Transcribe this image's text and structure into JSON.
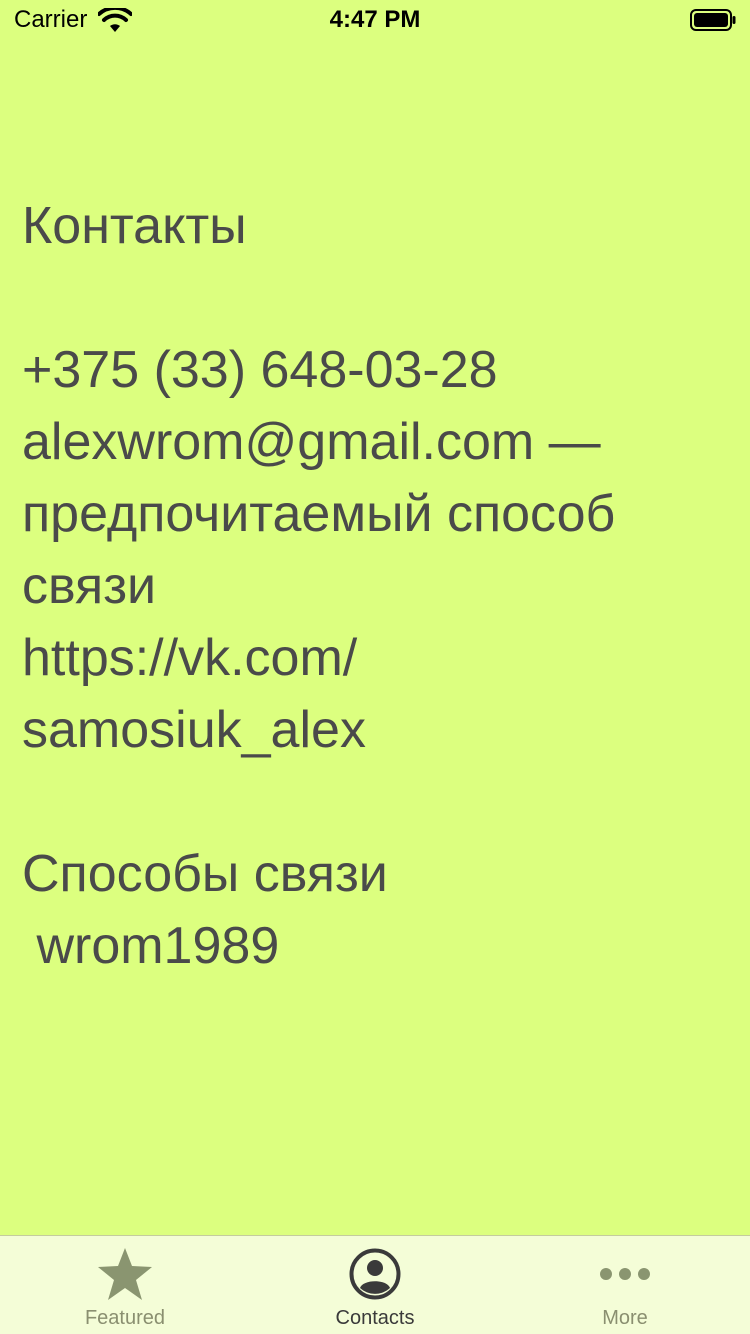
{
  "status_bar": {
    "carrier": "Carrier",
    "time": "4:47 PM"
  },
  "content": {
    "title": "Контакты",
    "phone": "+375 (33) 648-03-28",
    "email_line": "alexwrom@gmail.com —",
    "email_note_1": "предпочитаемый способ",
    "email_note_2": "связи",
    "vk_line_1": "https://vk.com/",
    "vk_line_2": "samosiuk_alex",
    "contact_methods_title": "Способы связи",
    "contact_methods_value": " wrom1989"
  },
  "tab_bar": {
    "tabs": [
      {
        "label": "Featured",
        "icon": "star-icon",
        "active": false
      },
      {
        "label": "Contacts",
        "icon": "contact-icon",
        "active": true
      },
      {
        "label": "More",
        "icon": "more-icon",
        "active": false
      }
    ]
  },
  "colors": {
    "background": "#dcff7f",
    "text": "#4a4a4a",
    "tab_bar_background": "#f4fdd7",
    "tab_inactive": "#8a8f70",
    "tab_active": "#3a3a3a"
  }
}
